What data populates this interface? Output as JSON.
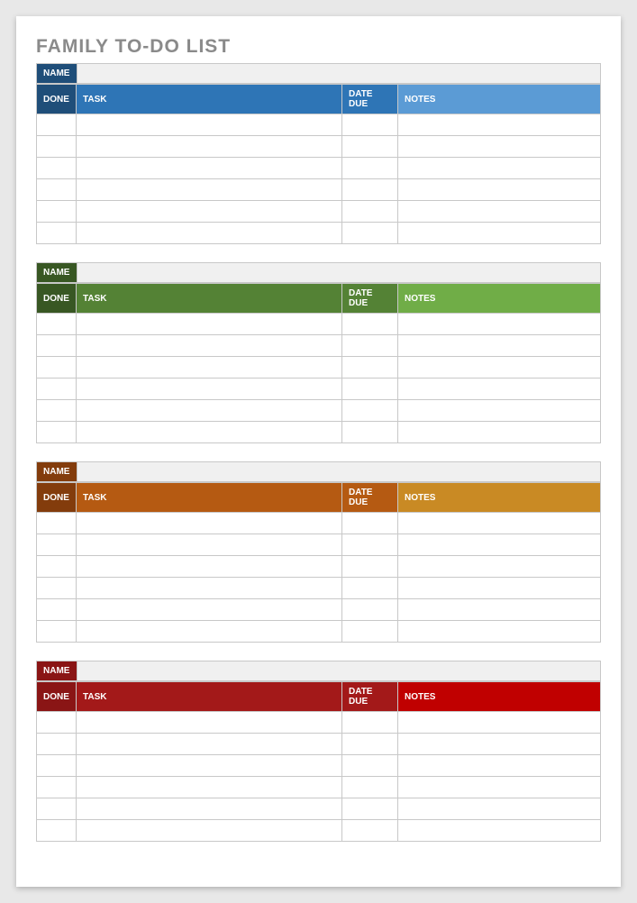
{
  "title": "FAMILY TO-DO LIST",
  "labels": {
    "name": "NAME",
    "done": "DONE",
    "task": "TASK",
    "date_due": "DATE DUE",
    "notes": "NOTES"
  },
  "sections": [
    {
      "name_value": "",
      "colors": {
        "name_bg": "#1f4e79",
        "done_bg": "#1f4e79",
        "task_bg": "#2e75b6",
        "due_bg": "#2e75b6",
        "notes_bg": "#5b9bd5"
      },
      "rows": [
        {
          "done": "",
          "task": "",
          "date_due": "",
          "notes": ""
        },
        {
          "done": "",
          "task": "",
          "date_due": "",
          "notes": ""
        },
        {
          "done": "",
          "task": "",
          "date_due": "",
          "notes": ""
        },
        {
          "done": "",
          "task": "",
          "date_due": "",
          "notes": ""
        },
        {
          "done": "",
          "task": "",
          "date_due": "",
          "notes": ""
        },
        {
          "done": "",
          "task": "",
          "date_due": "",
          "notes": ""
        }
      ]
    },
    {
      "name_value": "",
      "colors": {
        "name_bg": "#385723",
        "done_bg": "#385723",
        "task_bg": "#548235",
        "due_bg": "#548235",
        "notes_bg": "#70ad47"
      },
      "rows": [
        {
          "done": "",
          "task": "",
          "date_due": "",
          "notes": ""
        },
        {
          "done": "",
          "task": "",
          "date_due": "",
          "notes": ""
        },
        {
          "done": "",
          "task": "",
          "date_due": "",
          "notes": ""
        },
        {
          "done": "",
          "task": "",
          "date_due": "",
          "notes": ""
        },
        {
          "done": "",
          "task": "",
          "date_due": "",
          "notes": ""
        },
        {
          "done": "",
          "task": "",
          "date_due": "",
          "notes": ""
        }
      ]
    },
    {
      "name_value": "",
      "colors": {
        "name_bg": "#833c0c",
        "done_bg": "#833c0c",
        "task_bg": "#b55a12",
        "due_bg": "#b55a12",
        "notes_bg": "#c98a24"
      },
      "rows": [
        {
          "done": "",
          "task": "",
          "date_due": "",
          "notes": ""
        },
        {
          "done": "",
          "task": "",
          "date_due": "",
          "notes": ""
        },
        {
          "done": "",
          "task": "",
          "date_due": "",
          "notes": ""
        },
        {
          "done": "",
          "task": "",
          "date_due": "",
          "notes": ""
        },
        {
          "done": "",
          "task": "",
          "date_due": "",
          "notes": ""
        },
        {
          "done": "",
          "task": "",
          "date_due": "",
          "notes": ""
        }
      ]
    },
    {
      "name_value": "",
      "colors": {
        "name_bg": "#8a1515",
        "done_bg": "#8a1515",
        "task_bg": "#a31919",
        "due_bg": "#a31919",
        "notes_bg": "#c00000"
      },
      "rows": [
        {
          "done": "",
          "task": "",
          "date_due": "",
          "notes": ""
        },
        {
          "done": "",
          "task": "",
          "date_due": "",
          "notes": ""
        },
        {
          "done": "",
          "task": "",
          "date_due": "",
          "notes": ""
        },
        {
          "done": "",
          "task": "",
          "date_due": "",
          "notes": ""
        },
        {
          "done": "",
          "task": "",
          "date_due": "",
          "notes": ""
        },
        {
          "done": "",
          "task": "",
          "date_due": "",
          "notes": ""
        }
      ]
    }
  ]
}
